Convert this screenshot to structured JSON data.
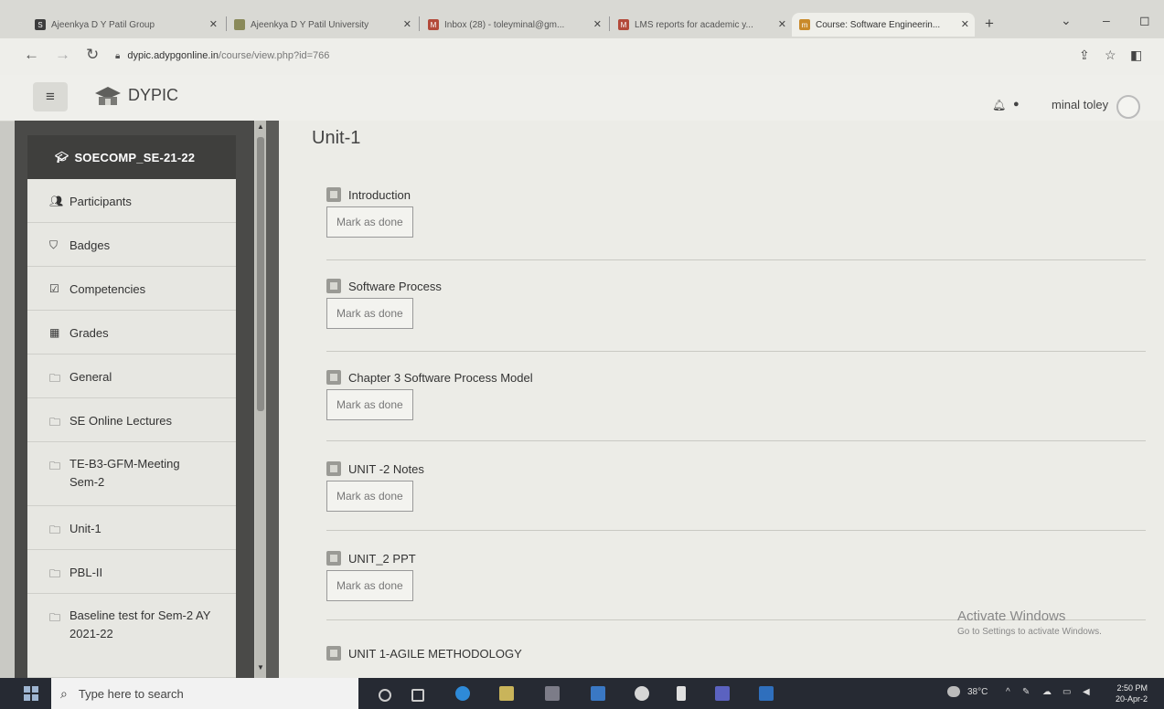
{
  "browser": {
    "tabs": [
      {
        "title": "Ajeenkya D Y Patil Group",
        "favicon": "S-logo",
        "active": false
      },
      {
        "title": "Ajeenkya D Y Patil University",
        "favicon": "crest-logo",
        "active": false
      },
      {
        "title": "Inbox (28) - toleyminal@gm...",
        "favicon": "gmail-icon",
        "active": false
      },
      {
        "title": "LMS reports for academic y...",
        "favicon": "gmail-icon",
        "active": false
      },
      {
        "title": "Course: Software Engineerin...",
        "favicon": "moodle-icon",
        "active": true
      }
    ],
    "url_host": "dypic.adypgonline.in",
    "url_path": "/course/view.php?id=766"
  },
  "header": {
    "menu_icon": "hamburger-icon",
    "site_name": "DYPIC",
    "user_name": "minal toley"
  },
  "sidebar": {
    "course_name": "SOECOMP_SE-21-22",
    "items": [
      {
        "label": "Participants",
        "icon": "users-icon"
      },
      {
        "label": "Badges",
        "icon": "shield-icon"
      },
      {
        "label": "Competencies",
        "icon": "checkbox-icon"
      },
      {
        "label": "Grades",
        "icon": "table-icon"
      },
      {
        "label": "General",
        "icon": "folder-icon"
      },
      {
        "label": "SE Online Lectures",
        "icon": "folder-icon"
      },
      {
        "label": "TE-B3-GFM-Meeting Sem-2",
        "icon": "folder-icon"
      },
      {
        "label": "Unit-1",
        "icon": "folder-icon"
      },
      {
        "label": "PBL-II",
        "icon": "folder-icon"
      },
      {
        "label": "Baseline test for Sem-2 AY 2021-22",
        "icon": "folder-icon"
      }
    ]
  },
  "main": {
    "section_title": "Unit-1",
    "activities": [
      {
        "name": "Introduction",
        "button": "Mark as done"
      },
      {
        "name": "Software Process",
        "button": "Mark as done"
      },
      {
        "name": "Chapter 3 Software Process Model",
        "button": "Mark as done"
      },
      {
        "name": "UNIT -2 Notes",
        "button": "Mark as done"
      },
      {
        "name": "UNIT_2 PPT",
        "button": "Mark as done"
      },
      {
        "name": "UNIT 1-AGILE METHODOLOGY",
        "button": ""
      }
    ]
  },
  "watermark": {
    "title": "Activate Windows",
    "subtitle": "Go to Settings to activate Windows."
  },
  "taskbar": {
    "search_placeholder": "Type here to search",
    "temperature": "38°C",
    "time": "2:50 PM",
    "date": "20-Apr-2"
  },
  "colors": {
    "drawer_dark": "#3f3f3d",
    "page_bg": "#ecece7",
    "taskbar": "#262a33"
  }
}
